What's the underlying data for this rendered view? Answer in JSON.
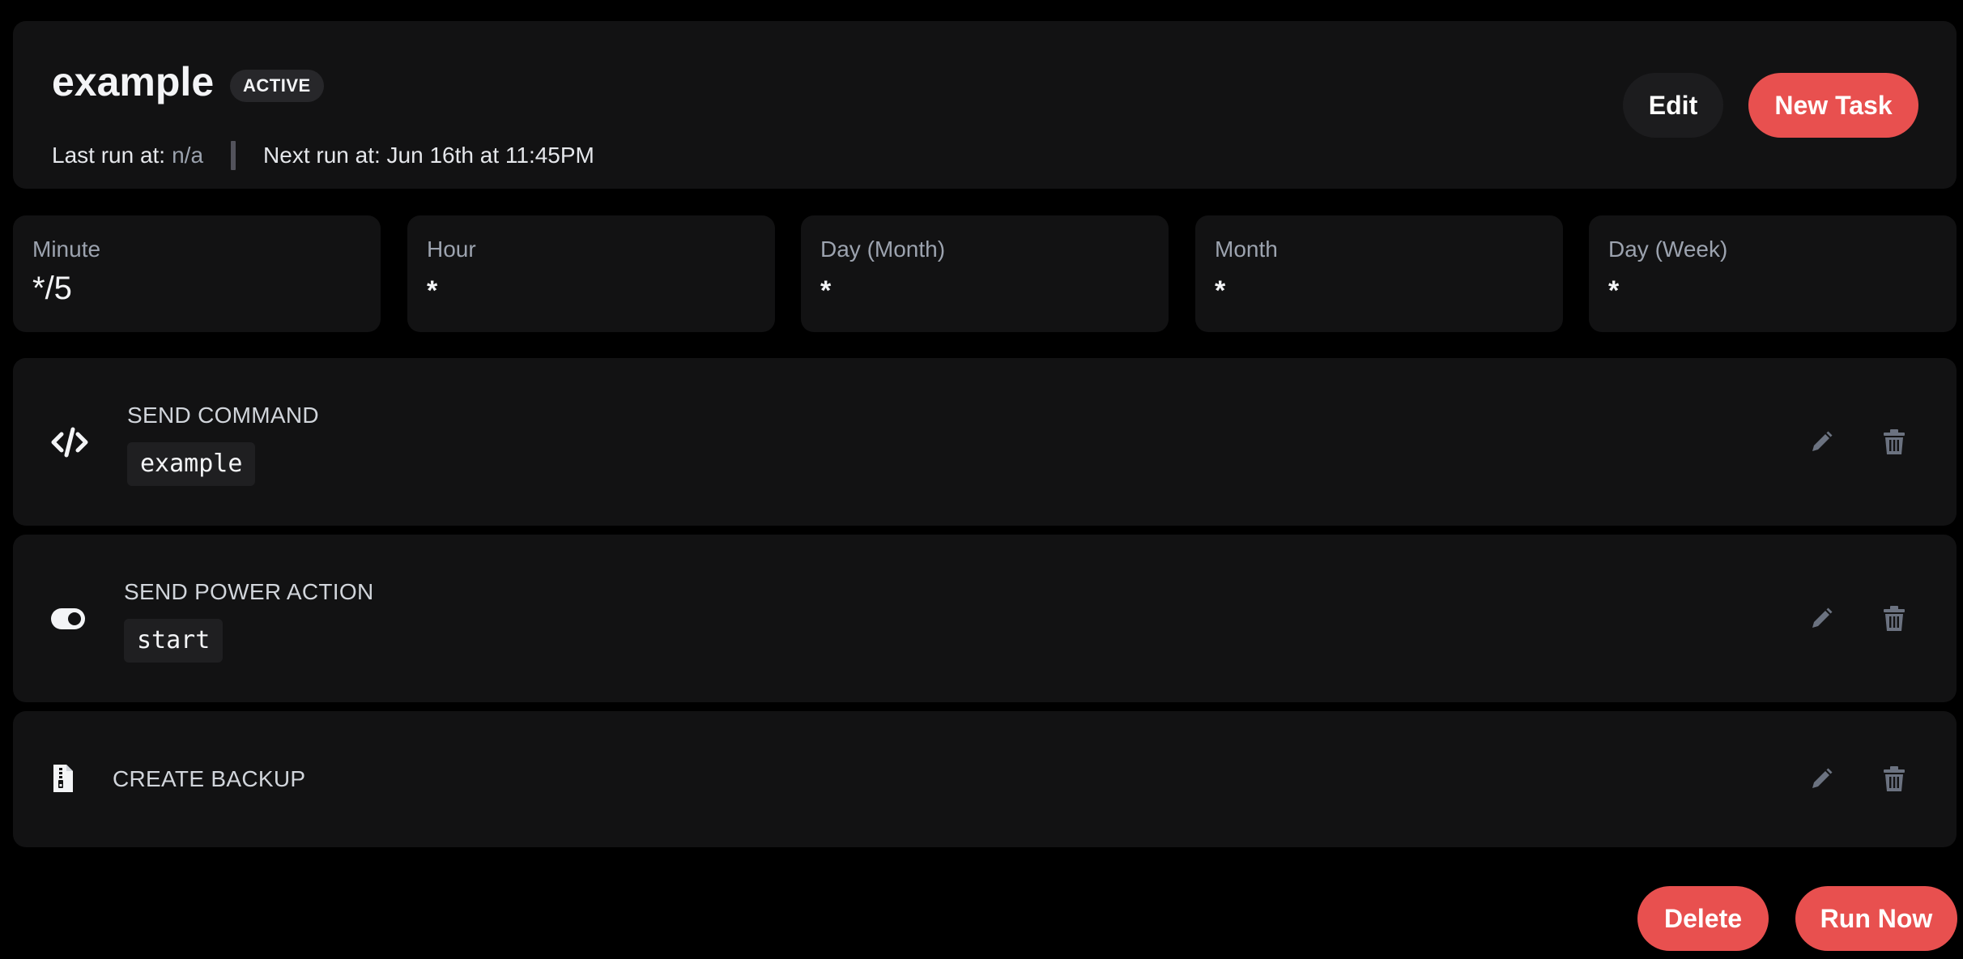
{
  "schedule": {
    "name": "example",
    "status": "ACTIVE",
    "last_run_label": "Last run at:",
    "last_run_value": "n/a",
    "next_run_label": "Next run at: Jun 16th at 11:45PM"
  },
  "header_buttons": {
    "edit": "Edit",
    "new_task": "New Task"
  },
  "cron": [
    {
      "label": "Minute",
      "value": "*/5"
    },
    {
      "label": "Hour",
      "value": "*"
    },
    {
      "label": "Day (Month)",
      "value": "*"
    },
    {
      "label": "Month",
      "value": "*"
    },
    {
      "label": "Day (Week)",
      "value": "*"
    }
  ],
  "tasks": [
    {
      "icon": "code-icon",
      "title": "SEND COMMAND",
      "payload": "example"
    },
    {
      "icon": "toggle-icon",
      "title": "SEND POWER ACTION",
      "payload": "start"
    },
    {
      "icon": "file-archive-icon",
      "title": "CREATE BACKUP"
    }
  ],
  "footer_buttons": {
    "delete": "Delete",
    "run_now": "Run Now"
  },
  "colors": {
    "background": "#000000",
    "card": "#121213",
    "accent": "#e8504f",
    "muted_text": "#9ca3af"
  }
}
